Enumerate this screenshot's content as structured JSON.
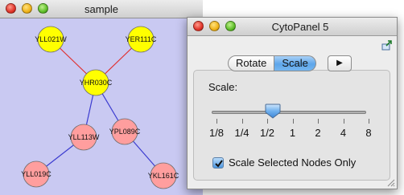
{
  "windows": {
    "network": {
      "title": "sample"
    },
    "panel": {
      "title": "CytoPanel 5",
      "tabs": [
        "Rotate",
        "Scale"
      ],
      "selected_tab": "Scale",
      "more_tabs_glyph": "▶",
      "scale_label": "Scale:",
      "slider": {
        "tick_labels": [
          "1/8",
          "1/4",
          "1/2",
          "1",
          "2",
          "4",
          "8"
        ],
        "value": "1/2"
      },
      "checkbox": {
        "label": "Scale Selected Nodes Only",
        "checked": true
      }
    }
  },
  "network": {
    "nodes": [
      {
        "id": "YLL021W",
        "color": "#ffff00"
      },
      {
        "id": "YER111C",
        "color": "#ffff00"
      },
      {
        "id": "YHR030C",
        "color": "#ffff00"
      },
      {
        "id": "YLL113W",
        "color": "#ff9e9e"
      },
      {
        "id": "YPL089C",
        "color": "#ff9e9e"
      },
      {
        "id": "YLL019C",
        "color": "#ff9e9e"
      },
      {
        "id": "YKL161C",
        "color": "#ff9e9e"
      }
    ],
    "edges": [
      {
        "source": "YLL021W",
        "target": "YHR030C",
        "color": "#e03030"
      },
      {
        "source": "YER111C",
        "target": "YHR030C",
        "color": "#e03030"
      },
      {
        "source": "YHR030C",
        "target": "YLL113W",
        "color": "#3c3cd0"
      },
      {
        "source": "YHR030C",
        "target": "YPL089C",
        "color": "#3c3cd0"
      },
      {
        "source": "YLL113W",
        "target": "YLL019C",
        "color": "#3c3cd0"
      },
      {
        "source": "YPL089C",
        "target": "YKL161C",
        "color": "#3c3cd0"
      }
    ]
  }
}
